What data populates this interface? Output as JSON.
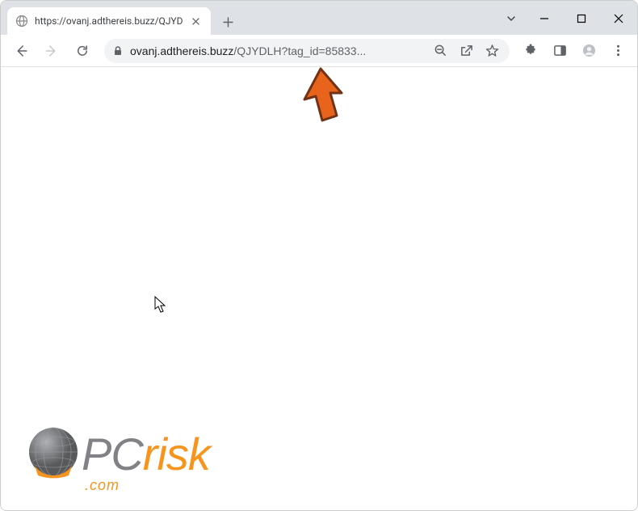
{
  "window": {
    "tab_title": "https://ovanj.adthereis.buzz/QJYD"
  },
  "toolbar": {
    "url_domain": "ovanj.adthereis.buzz",
    "url_path": "/QJYDLH?tag_id=85833..."
  },
  "watermark": {
    "text_pc": "PC",
    "text_risk": "risk",
    "subtitle": ".com"
  },
  "colors": {
    "arrow": "#E8631C",
    "arrow_outline": "#713215",
    "brand_orange": "#f7941e",
    "brand_gray": "#808285"
  }
}
